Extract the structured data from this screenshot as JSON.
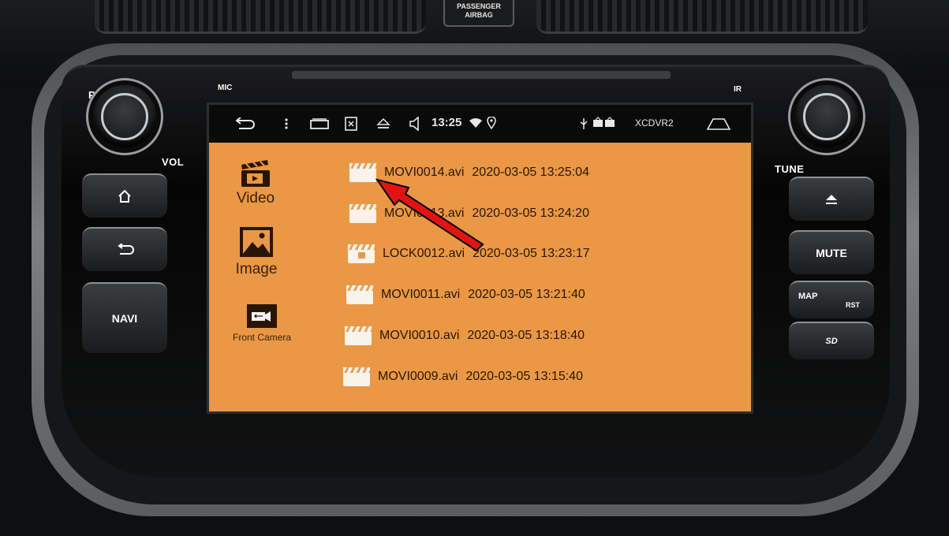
{
  "dashboard": {
    "airbag_label": "PASSENGER\nAIRBAG",
    "mic_label": "MIC",
    "ir_label": "IR",
    "pwr_label": "PW",
    "vol_label": "VOL",
    "tune_label": "TUNE",
    "left_buttons": [
      {
        "icon": "home-icon"
      },
      {
        "icon": "back-icon"
      },
      {
        "label": "NAVI"
      }
    ],
    "right_buttons": [
      {
        "icon": "eject-icon"
      },
      {
        "label": "MUTE"
      },
      {
        "label": "MAP",
        "sublabel": "RST"
      },
      {
        "label": "SD"
      }
    ]
  },
  "status_bar": {
    "time": "13:25",
    "device_name": "XCDVR2",
    "icons": [
      "back-arrow-icon",
      "menu-dots-icon",
      "recent-apps-icon",
      "screenshot-icon",
      "eject-icon",
      "volume-icon",
      "wifi-icon",
      "location-icon",
      "usb-icon",
      "dvr-icon",
      "home-icon"
    ]
  },
  "sidebar": {
    "items": [
      {
        "label": "Video",
        "icon": "video-clapper-icon"
      },
      {
        "label": "Image",
        "icon": "image-icon"
      },
      {
        "label": "Front Camera",
        "icon": "front-camera-icon"
      }
    ]
  },
  "files": [
    {
      "name": "MOVI0014.avi",
      "date": "2020-03-05 13:25:04",
      "locked": false
    },
    {
      "name": "MOVI0013.avi",
      "date": "2020-03-05 13:24:20",
      "locked": false
    },
    {
      "name": "LOCK0012.avi",
      "date": "2020-03-05 13:23:17",
      "locked": true
    },
    {
      "name": "MOVI0011.avi",
      "date": "2020-03-05 13:21:40",
      "locked": false
    },
    {
      "name": "MOVI0010.avi",
      "date": "2020-03-05 13:18:40",
      "locked": false
    },
    {
      "name": "MOVI0009.avi",
      "date": "2020-03-05 13:15:40",
      "locked": false
    }
  ],
  "colors": {
    "screen_background": "#ea9845",
    "annotation_arrow": "#e11414"
  }
}
